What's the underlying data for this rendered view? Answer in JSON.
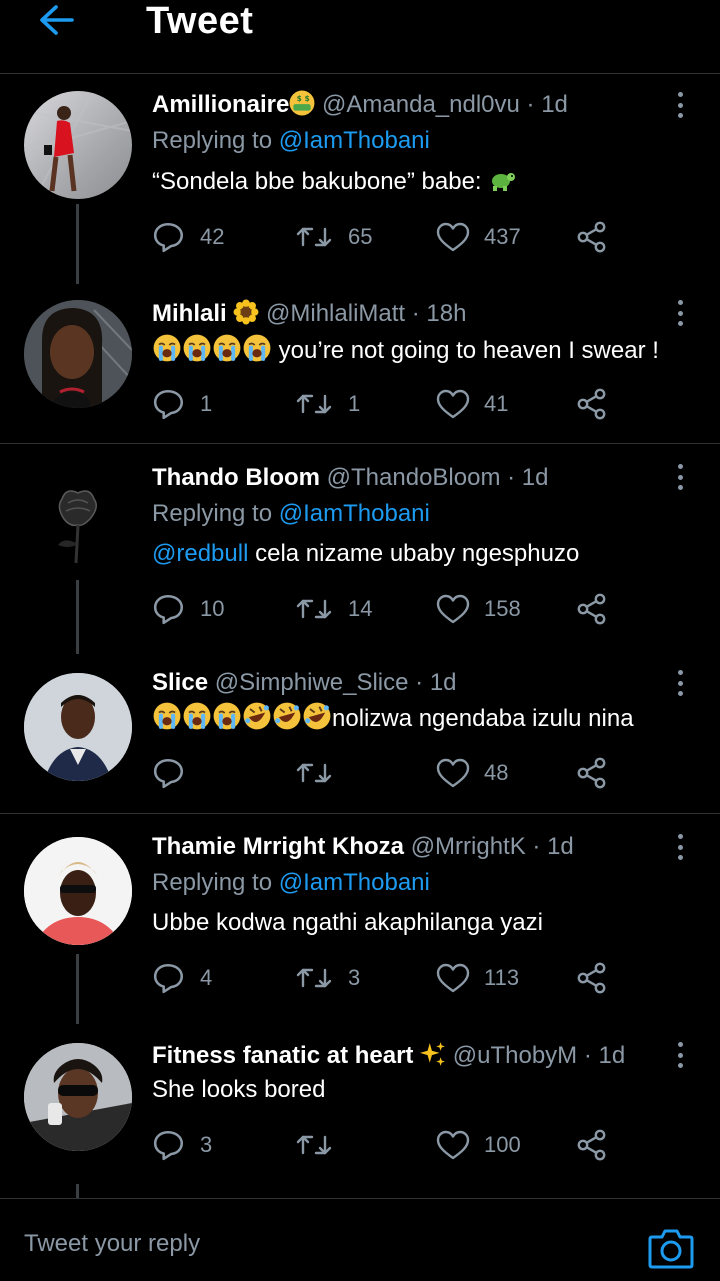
{
  "header": {
    "title": "Tweet",
    "back_icon": "arrow-left-icon"
  },
  "colors": {
    "accent": "#1d9bf0",
    "muted": "#8b98a5",
    "background": "#000000"
  },
  "tweets": [
    {
      "name": "Amillionaire",
      "name_emoji": "money-mouth-face",
      "handle": "@Amanda_ndl0vu",
      "time": "· 1d",
      "replying_prefix": "Replying to ",
      "replying_to": "@IamThobani",
      "text": "“Sondela bbe bakubone” babe: ",
      "text_emoji": "turtle",
      "replies": "42",
      "retweets": "65",
      "likes": "437"
    },
    {
      "name": "Mihlali",
      "name_emoji": "sunflower",
      "handle": "@MihlaliMatt",
      "time": "· 18h",
      "text_emojis": "crying x4",
      "text": "you’re not going to heaven I swear !",
      "replies": "1",
      "retweets": "1",
      "likes": "41"
    },
    {
      "name": "Thando Bloom",
      "handle": "@ThandoBloom",
      "time": "· 1d",
      "replying_prefix": "Replying to ",
      "replying_to": "@IamThobani",
      "text_mention": "@redbull",
      "text": " cela nizame ubaby ngesphuzo",
      "replies": "10",
      "retweets": "14",
      "likes": "158"
    },
    {
      "name": "Slice",
      "handle": "@Simphiwe_Slice",
      "time": "· 1d",
      "text_emojis": "crying x3, rofl x3",
      "text": "nolizwa ngendaba izulu nina",
      "replies": "",
      "retweets": "",
      "likes": "48"
    },
    {
      "name": "Thamie Mrright Khoza",
      "handle": "@MrrightK",
      "time": "· 1d",
      "replying_prefix": "Replying to ",
      "replying_to": "@IamThobani",
      "text": "Ubbe kodwa ngathi akaphilanga yazi",
      "replies": "4",
      "retweets": "3",
      "likes": "113"
    },
    {
      "name": "Fitness fanatic at heart",
      "name_emoji": "sparkles",
      "handle": "@uThobyM",
      "time": "· 1d",
      "text": "She looks bored",
      "replies": "3",
      "retweets": "",
      "likes": "100"
    }
  ],
  "footer": {
    "placeholder": "Tweet your reply",
    "camera_icon": "camera-icon"
  }
}
